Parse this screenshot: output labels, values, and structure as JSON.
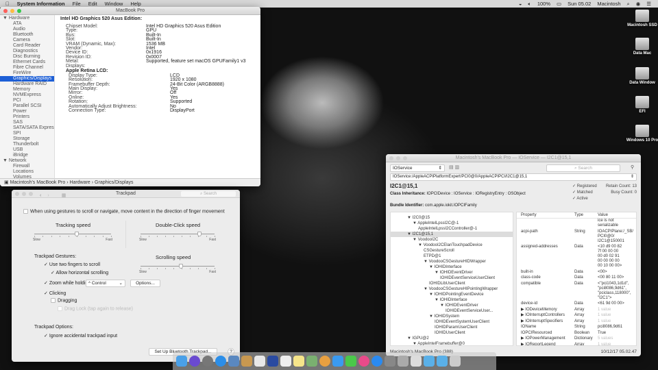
{
  "menubar": {
    "app": "System Information",
    "items": [
      "File",
      "Edit",
      "Window",
      "Help"
    ],
    "battery": "100%",
    "clock": "Sun 05.02",
    "user": "Macintosh"
  },
  "sysinfo": {
    "title": "MacBook Pro",
    "sidebar": [
      {
        "label": "Hardware",
        "group": true
      },
      {
        "label": "ATA"
      },
      {
        "label": "Audio"
      },
      {
        "label": "Bluetooth"
      },
      {
        "label": "Camera"
      },
      {
        "label": "Card Reader"
      },
      {
        "label": "Diagnostics"
      },
      {
        "label": "Disc Burning"
      },
      {
        "label": "Ethernet Cards"
      },
      {
        "label": "Fibre Channel"
      },
      {
        "label": "FireWire"
      },
      {
        "label": "Graphics/Displays",
        "selected": true
      },
      {
        "label": "Hardware RAID"
      },
      {
        "label": "Memory"
      },
      {
        "label": "NVMExpress"
      },
      {
        "label": "PCI"
      },
      {
        "label": "Parallel SCSI"
      },
      {
        "label": "Power"
      },
      {
        "label": "Printers"
      },
      {
        "label": "SAS"
      },
      {
        "label": "SATA/SATA Express"
      },
      {
        "label": "SPI"
      },
      {
        "label": "Storage"
      },
      {
        "label": "Thunderbolt"
      },
      {
        "label": "USB"
      },
      {
        "label": "iBridge"
      },
      {
        "label": "Network",
        "group": true
      },
      {
        "label": "Firewall"
      },
      {
        "label": "Locations"
      },
      {
        "label": "Volumes"
      }
    ],
    "heading": "Intel HD Graphics 520 Asus Edition:",
    "rows": [
      {
        "k": "Chipset Model:",
        "v": "Intel HD Graphics 520 Asus Edition",
        "lvl": 1
      },
      {
        "k": "Type:",
        "v": "GPU",
        "lvl": 1
      },
      {
        "k": "Bus:",
        "v": "Built-In",
        "lvl": 1
      },
      {
        "k": "Slot:",
        "v": "Built-In",
        "lvl": 1
      },
      {
        "k": "VRAM (Dynamic, Max):",
        "v": "1536 MB",
        "lvl": 1
      },
      {
        "k": "Vendor:",
        "v": "Intel",
        "lvl": 1
      },
      {
        "k": "Device ID:",
        "v": "0x1916",
        "lvl": 1
      },
      {
        "k": "Revision ID:",
        "v": "0x0007",
        "lvl": 1
      },
      {
        "k": "Metal:",
        "v": "Supported, feature set macOS GPUFamily1 v3",
        "lvl": 1
      },
      {
        "k": "Displays:",
        "v": "",
        "lvl": 1
      },
      {
        "k": "Apple Retina LCD:",
        "v": "",
        "lvl": "h"
      },
      {
        "k": "Display Type:",
        "v": "LCD",
        "lvl": 2
      },
      {
        "k": "Resolution:",
        "v": "1920 x 1080",
        "lvl": 2
      },
      {
        "k": "Framebuffer Depth:",
        "v": "24-Bit Color (ARGB8888)",
        "lvl": 2
      },
      {
        "k": "Main Display:",
        "v": "Yes",
        "lvl": 2
      },
      {
        "k": "Mirror:",
        "v": "Off",
        "lvl": 2
      },
      {
        "k": "Online:",
        "v": "Yes",
        "lvl": 2
      },
      {
        "k": "Rotation:",
        "v": "Supported",
        "lvl": 2
      },
      {
        "k": "Automatically Adjust Brightness:",
        "v": "No",
        "lvl": 2
      },
      {
        "k": "Connection Type:",
        "v": "DisplayPort",
        "lvl": 2
      }
    ],
    "path": "Macintosh's MacBook Pro  ›  Hardware  ›  Graphics/Displays"
  },
  "trackpad": {
    "title": "Trackpad",
    "search": "Search",
    "natural": "When using gestures to scroll or navigate, move content in the direction of finger movement",
    "tracking": {
      "label": "Tracking speed",
      "value": 0.55,
      "slow": "Slow",
      "fast": "Fast"
    },
    "doubleclick": {
      "label": "Double-Click speed",
      "value": 0.8,
      "slow": "Slow",
      "fast": "Fast"
    },
    "scrolling": {
      "label": "Scrolling speed",
      "value": 0.55,
      "slow": "Slow",
      "fast": "Fast"
    },
    "gestures_label": "Trackpad Gestures:",
    "two_fingers": "Use two fingers to scroll",
    "horizontal": "Allow horizontal scrolling",
    "zoom": "Zoom while holding",
    "zoom_key": "^ Control",
    "options": "Options...",
    "clicking": "Clicking",
    "dragging": "Dragging",
    "draglock": "Drag Lock (tap again to release)",
    "options_label": "Trackpad Options:",
    "ignore": "Ignore accidental trackpad input",
    "bt": "Set Up Bluetooth Trackpad...",
    "help": "?"
  },
  "ioreg": {
    "title": "Macintosh's MacBook Pro — IOService — I2C1@15,1",
    "plane": "IOService",
    "search": "Search",
    "path": "IOService:/AppleACPIPlatformExpert/PCI0@0/AppleACPIPCI/I2C1@15,1",
    "name": "I2C1@15,1",
    "inherit_label": "Class Inheritance:",
    "inherit": "IOPCIDevice : IOService : IORegistryEntry : OSObject",
    "bundle_label": "Bundle Identifier:",
    "bundle": "com.apple.iokit.IOPCIFamily",
    "flags": [
      "Registered",
      "Matched",
      "Active"
    ],
    "retain_label": "Retain Count:",
    "retain": "13",
    "busy_label": "Busy Count:",
    "busy": "0",
    "tree": [
      {
        "t": "▼ I2C0@15",
        "d": 3
      },
      {
        "t": "▼ AppleIntelLpssI2C@-1",
        "d": 4
      },
      {
        "t": "AppleIntelLpssI2CController@-1",
        "d": 5
      },
      {
        "t": "▼ I2C1@15,1",
        "d": 3,
        "sel": true
      },
      {
        "t": "▼ VoodooI2C",
        "d": 4
      },
      {
        "t": "▼ VoodooI2CElanTouchpadDevice",
        "d": 5
      },
      {
        "t": "CSGestureScroll",
        "d": 6
      },
      {
        "t": "ETPD@1",
        "d": 6
      },
      {
        "t": "▼ VoodooCSGestureHIDWrapper",
        "d": 6
      },
      {
        "t": "▼ IOHIDInterface",
        "d": 7
      },
      {
        "t": "▼ IOHIDEventDriver",
        "d": 8
      },
      {
        "t": "IOHIDEventServiceUserClient",
        "d": 9
      },
      {
        "t": "IOHIDLibUserClient",
        "d": 7
      },
      {
        "t": "▼ VoodooCSGestureHIPointingWrapper",
        "d": 6
      },
      {
        "t": "▼ IOHIDPointingEventDevice",
        "d": 7
      },
      {
        "t": "▼ IOHIDInterface",
        "d": 8
      },
      {
        "t": "▼ IOHIDEventDriver",
        "d": 9
      },
      {
        "t": "IOHIDEventServiceUser...",
        "d": 10
      },
      {
        "t": "▼ IOHIDSystem",
        "d": 7
      },
      {
        "t": "IOHIDEventSystemUserClient",
        "d": 8
      },
      {
        "t": "IOHIDParamUserClient",
        "d": 8
      },
      {
        "t": "IOHIDUserClient",
        "d": 8
      },
      {
        "t": "▼ IGPU@2",
        "d": 3
      },
      {
        "t": "▼ AppleIntelFramebuffer@0",
        "d": 4
      }
    ],
    "prop_headers": [
      "Property",
      "Type",
      "Value"
    ],
    "props": [
      {
        "p": "",
        "t": "",
        "v": "ice is not\nserializable"
      },
      {
        "p": "acpi-path",
        "t": "String",
        "v": "IOACPIPlane:/_SB/\nPCI0@0/\nI2C1@150001"
      },
      {
        "p": "assigned-addresses",
        "t": "Data",
        "v": "<10 d9 00 82\n 7f 00 00 00\n 00 d0 02 91\n 00 00 00 00\n 00 10 00 00>"
      },
      {
        "p": "built-in",
        "t": "Data",
        "v": "<00>"
      },
      {
        "p": "class-code",
        "t": "Data",
        "v": "<00 80 11 00>"
      },
      {
        "p": "compatible",
        "t": "Data",
        "v": "<\"pci1043,1d1d\",\n\"pci8086,9d61\",\n\"pciclass,118000\",\n\"I2C1\">"
      },
      {
        "p": "device-id",
        "t": "Data",
        "v": "<61 9d 00 00>"
      },
      {
        "p": "▶ IODeviceMemory",
        "t": "Array",
        "v": "1 value",
        "dim": true
      },
      {
        "p": "▶ IOInterruptControllers",
        "t": "Array",
        "v": "1 value",
        "dim": true
      },
      {
        "p": "▶ IOInterruptSpecifiers",
        "t": "Array",
        "v": "1 value",
        "dim": true
      },
      {
        "p": "IOName",
        "t": "String",
        "v": "pci8086,9d61"
      },
      {
        "p": "IOPCIResourced",
        "t": "Boolean",
        "v": "True"
      },
      {
        "p": "▶ IOPowerManagement",
        "t": "Dictionary",
        "v": "5 values",
        "dim": true
      },
      {
        "p": "▶ IOReportLegend",
        "t": "Array",
        "v": "1 value",
        "dim": true
      }
    ],
    "status_left": "Macintosh's MacBook Pro (388)",
    "status_right": "10/12/17 05.02.47"
  },
  "desktop_icons": [
    "Macintosh SSD",
    "Data Mac",
    "Data Window",
    "EFI",
    "Windows 10 Pro"
  ],
  "dock_colors": [
    "#4aa0e8",
    "#6a4ad0",
    "#777",
    "#2c8ee8",
    "#5a88c0",
    "#c89850",
    "#e8e8e8",
    "#2a4aa0",
    "#eee",
    "#f6e58a",
    "#7ab070",
    "#e8a040",
    "#3a9af0",
    "#4ac84a",
    "#e84a8a",
    "#2a8af0",
    "#888",
    "#aaa",
    "#ddd",
    "#5ab0e8",
    "#5ab0e8",
    "#ccc"
  ]
}
